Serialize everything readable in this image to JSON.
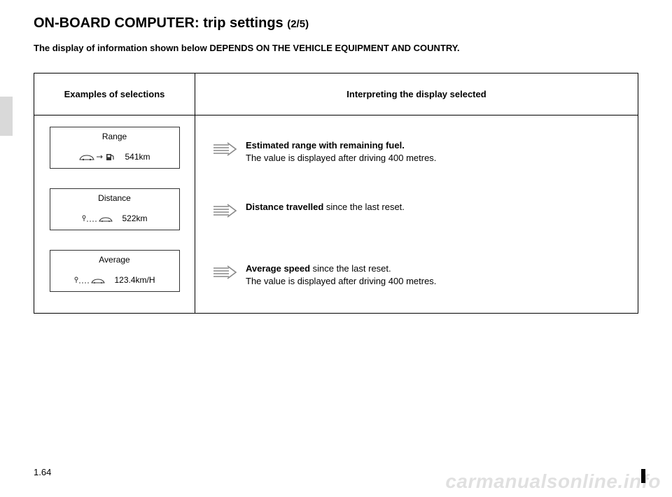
{
  "title_main": "ON-BOARD COMPUTER: trip settings ",
  "title_sub": "(2/5)",
  "equipment_note": "The display of information shown below DEPENDS ON THE VEHICLE EQUIPMENT AND COUNTRY.",
  "headers": {
    "left": "Examples of selections",
    "right": "Interpreting the display selected"
  },
  "rows": [
    {
      "display_label": "Range",
      "display_value": "541km",
      "icon": "range",
      "desc_bold": "Estimated range with remaining fuel.",
      "desc_plain": "The value is displayed after driving 400 metres."
    },
    {
      "display_label": "Distance",
      "display_value": "522km",
      "icon": "distance",
      "desc_bold": "Distance travelled",
      "desc_plain_inline": " since the last reset.",
      "desc_plain": ""
    },
    {
      "display_label": "Average",
      "display_value": "123.4km/H",
      "icon": "distance",
      "desc_bold": "Average speed",
      "desc_plain_inline": " since the last reset.",
      "desc_plain": "The value is displayed after driving 400 metres."
    }
  ],
  "page_number": "1.64",
  "watermark": "carmanualsonline.info"
}
